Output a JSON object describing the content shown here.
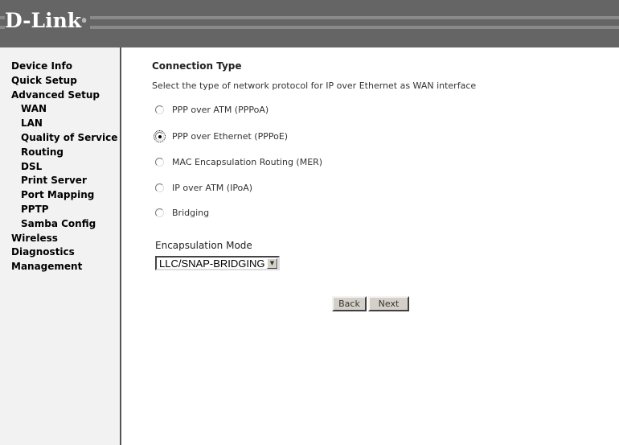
{
  "header": {
    "logo": "D-Link"
  },
  "sidebar": {
    "items": [
      {
        "label": "Device Info",
        "sub": false
      },
      {
        "label": "Quick Setup",
        "sub": false
      },
      {
        "label": "Advanced Setup",
        "sub": false
      },
      {
        "label": "WAN",
        "sub": true
      },
      {
        "label": "LAN",
        "sub": true
      },
      {
        "label": "Quality of Service",
        "sub": true
      },
      {
        "label": "Routing",
        "sub": true
      },
      {
        "label": "DSL",
        "sub": true
      },
      {
        "label": "Print Server",
        "sub": true
      },
      {
        "label": "Port Mapping",
        "sub": true
      },
      {
        "label": "PPTP",
        "sub": true
      },
      {
        "label": "Samba Config",
        "sub": true
      },
      {
        "label": "Wireless",
        "sub": false
      },
      {
        "label": "Diagnostics",
        "sub": false
      },
      {
        "label": "Management",
        "sub": false
      }
    ]
  },
  "main": {
    "title": "Connection Type",
    "description": "Select the type of network protocol for IP over Ethernet as WAN interface",
    "options": [
      {
        "label": "PPP over ATM (PPPoA)",
        "selected": false
      },
      {
        "label": "PPP over Ethernet (PPPoE)",
        "selected": true
      },
      {
        "label": "MAC Encapsulation Routing (MER)",
        "selected": false
      },
      {
        "label": "IP over ATM (IPoA)",
        "selected": false
      },
      {
        "label": "Bridging",
        "selected": false
      }
    ],
    "encapsulation_label": "Encapsulation Mode",
    "encapsulation_value": "LLC/SNAP-BRIDGING",
    "back_label": "Back",
    "next_label": "Next"
  }
}
